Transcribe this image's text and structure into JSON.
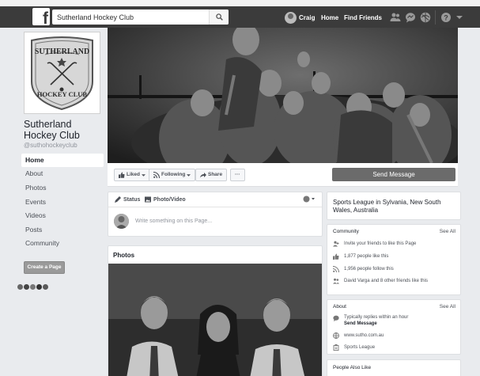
{
  "topbar": {
    "logo": "f",
    "search_value": "Sutherland Hockey Club",
    "profile_name": "Craig",
    "home_label": "Home",
    "find_friends_label": "Find Friends",
    "icons": [
      "friend-requests-icon",
      "messages-icon",
      "notifications-icon",
      "help-icon",
      "account-menu-icon"
    ]
  },
  "page": {
    "name": "Sutherland Hockey Club",
    "handle": "@suthohockeyclub",
    "logo_text": {
      "line1": "SUTHERLAND",
      "line2": "HOCKEY CLUB"
    }
  },
  "left_nav": {
    "items": [
      {
        "label": "Home",
        "active": true
      },
      {
        "label": "About"
      },
      {
        "label": "Photos"
      },
      {
        "label": "Events"
      },
      {
        "label": "Videos"
      },
      {
        "label": "Posts"
      },
      {
        "label": "Community"
      }
    ],
    "create_page": "Create a Page"
  },
  "actions": {
    "liked": "Liked",
    "following": "Following",
    "share": "Share",
    "more": "···",
    "send_message": "Send Message"
  },
  "composer": {
    "status_tab": "Status",
    "photo_tab": "Photo/Video",
    "placeholder": "Write something on this Page..."
  },
  "photos": {
    "title": "Photos"
  },
  "about": {
    "category": "Sports League in Sylvania, New South Wales, Australia"
  },
  "community": {
    "title": "Community",
    "see_all": "See All",
    "invite": "Invite your friends to like this Page",
    "likes": "1,877 people like this",
    "follows": "1,956 people follow this",
    "friends": "David Varga and 8 other friends like this"
  },
  "about_card": {
    "title": "About",
    "see_all": "See All",
    "response_line1": "Typically replies within an hour",
    "response_line2": "Send Message",
    "website": "www.sutho.com.au",
    "category": "Sports League"
  },
  "people_also_like": {
    "title": "People Also Like"
  },
  "colors": {
    "topbar": "#3b3b3b",
    "background": "#e9ebee",
    "send_button": "#6b6b6b"
  }
}
